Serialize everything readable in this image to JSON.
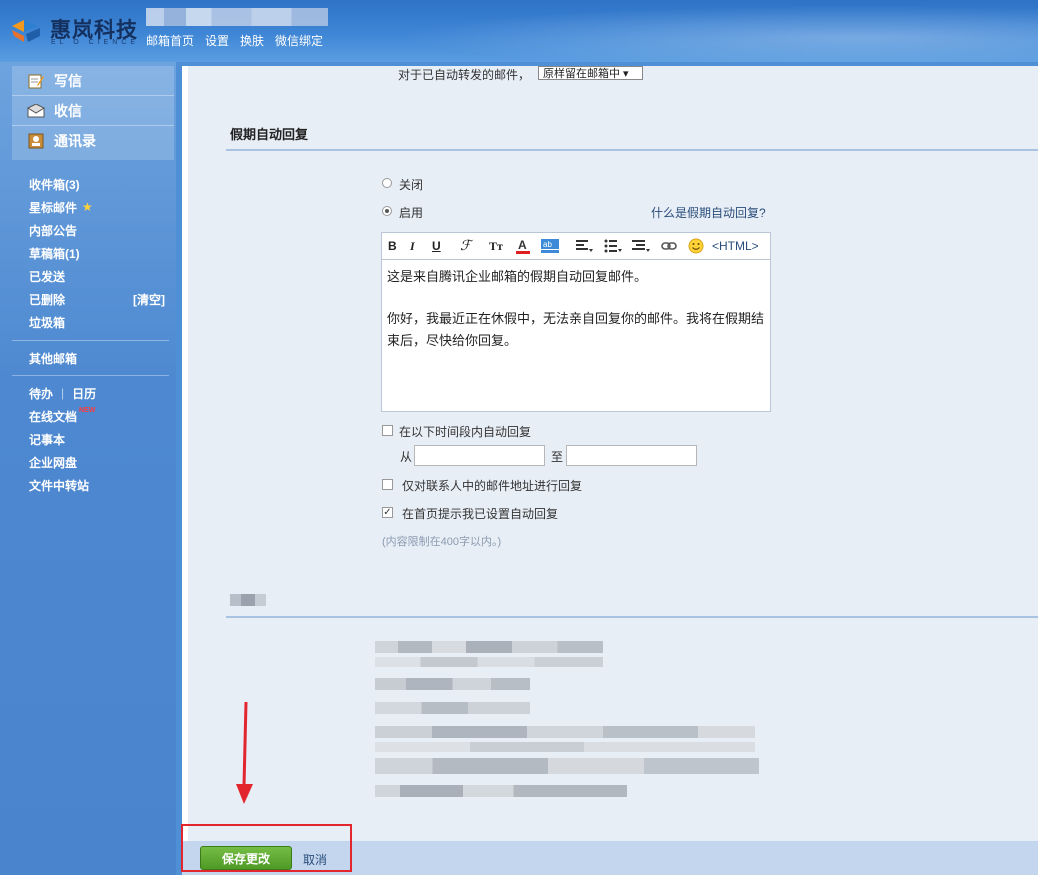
{
  "brand": {
    "name": "惠岚科技",
    "sub": "EL  O  CIENCE"
  },
  "topnav": [
    "邮箱首页",
    "设置",
    "换肤",
    "微信绑定"
  ],
  "sidebar": {
    "quick": [
      {
        "label": "写信",
        "icon": "compose-icon"
      },
      {
        "label": "收信",
        "icon": "inbox-icon"
      },
      {
        "label": "通讯录",
        "icon": "contacts-icon"
      }
    ],
    "folders": [
      "收件箱(3)",
      "星标邮件",
      "内部公告",
      "草稿箱(1)",
      "已发送",
      "已删除",
      "垃圾箱"
    ],
    "trash_clear": "[清空]",
    "other_mail": "其他邮箱",
    "tools": {
      "todo": "待办",
      "sep": "|",
      "calendar": "日历",
      "docs": "在线文档",
      "docs_badge": "NEW",
      "notes": "记事本",
      "netdisk": "企业网盘",
      "transfer": "文件中转站"
    }
  },
  "forward": {
    "label": "对于已自动转发的邮件，",
    "select_value": "原样留在邮箱中 ▾"
  },
  "vacation": {
    "title": "假期自动回复",
    "off_label": "关闭",
    "on_label": "启用",
    "help_link": "什么是假期自动回复?",
    "editor": {
      "line1": "这是来自腾讯企业邮箱的假期自动回复邮件。",
      "line2": "你好，我最近正在休假中，无法亲自回复你的邮件。我将在假期结束后，尽快给你回复。",
      "html_label": "<HTML>"
    },
    "period_label": "在以下时间段内自动回复",
    "from_label": "从",
    "to_label": "至",
    "contacts_only_label": "仅对联系人中的邮件地址进行回复",
    "home_notice_label": "在首页提示我已设置自动回复",
    "limit_note": "(内容限制在400字以内。)",
    "enabled": true,
    "period_checked": false,
    "contacts_only_checked": false,
    "home_notice_checked": true
  },
  "footer": {
    "save_label": "保存更改",
    "cancel_label": "取消"
  },
  "colors": {
    "accent_blue": "#4f8fd6",
    "save_green": "#4e9a25",
    "highlight_red": "#e3262d"
  }
}
